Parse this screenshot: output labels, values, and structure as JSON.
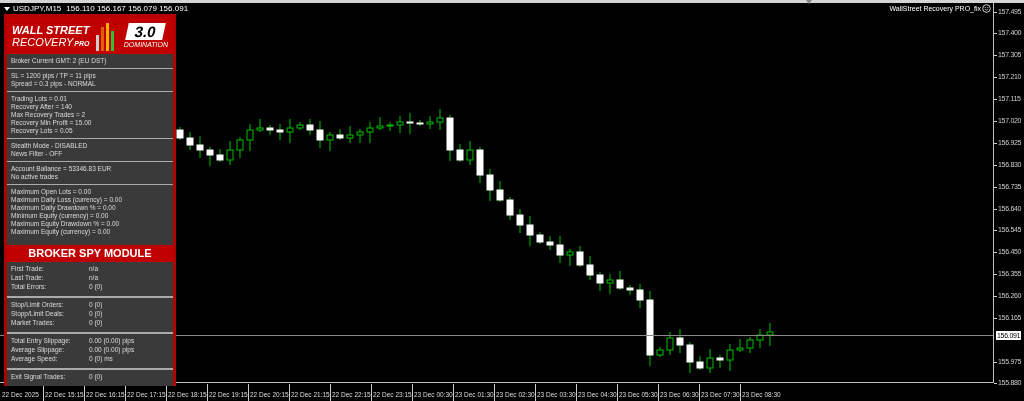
{
  "chart_header": {
    "symbol": "USDJPY,M15",
    "quotes": "156.110 156.167 156.079 156.091",
    "expert": "WallStreet Recovery PRO_fix"
  },
  "panel": {
    "logo": {
      "line1": "WALL STREET",
      "line2": "RECOVERY",
      "suffix": "PRO",
      "version": "3.0",
      "edition": "DOMINATION"
    },
    "sections": [
      [
        "Broker Current GMT: 2 (EU DST)"
      ],
      [
        "SL = 1200 pips / TP = 11 pips",
        "Spread = 0.3 pips - NORMAL"
      ],
      [
        "Trading Lots = 0.01",
        "Recovery After = 140",
        "Max Recovery Trades = 2",
        "Recovery Min Profit = 15.00",
        "Recovery Lots = 0.05"
      ],
      [
        "Stealth Mode - DISABLED",
        "News Filter - OFF"
      ],
      [
        "Account Ballance = 53346.83 EUR",
        "No active trades"
      ],
      [
        "Maximum Open Lots = 0.00",
        "Maximum Daily Loss (currency) = 0.00",
        "Maximum Daily Drawdown % = 0.00",
        "Minimum Equity (currency) = 0.00",
        "Maximum Equity Drawdown % = 0.00",
        "Maximum Equity (currency) = 0.00"
      ]
    ],
    "spy_title": "BROKER SPY MODULE",
    "spy_sections": [
      [
        {
          "label": "First Trade:",
          "value": "n/a"
        },
        {
          "label": "Last Trade:",
          "value": "n/a"
        },
        {
          "label": "Total Errors:",
          "value": "0 (0)"
        }
      ],
      [
        {
          "label": "Stop/Limit Orders:",
          "value": "0 (0)"
        },
        {
          "label": "Stopp/Limit Deals:",
          "value": "0 (0)"
        },
        {
          "label": "Market Trades:",
          "value": "0 (0)"
        }
      ],
      [
        {
          "label": "Total Entry Slippage:",
          "value": "0.00 (0.00) pips"
        },
        {
          "label": "Average Slippage:",
          "value": "0.00 (0.00) pips"
        },
        {
          "label": "Average Speed:",
          "value": "0 (0) ms"
        }
      ],
      [
        {
          "label": "Exit Signal Trades:",
          "value": "0 (0)"
        }
      ]
    ]
  },
  "price_axis": [
    "157.495",
    "157.400",
    "157.305",
    "157.210",
    "157.115",
    "157.020",
    "156.925",
    "156.830",
    "156.735",
    "156.640",
    "156.545",
    "156.450",
    "156.355",
    "156.260",
    "156.165",
    "155.975",
    "155.880"
  ],
  "current_price": "156.091",
  "time_axis": [
    "22 Dec 2025",
    "22 Dec 15:15",
    "22 Dec 16:15",
    "22 Dec 17:15",
    "22 Dec 18:15",
    "22 Dec 19:15",
    "22 Dec 20:15",
    "22 Dec 21:15",
    "22 Dec 22:15",
    "22 Dec 23:15",
    "23 Dec 00:30",
    "23 Dec 01:30",
    "23 Dec 02:30",
    "23 Dec 03:30",
    "23 Dec 04:30",
    "23 Dec 05:30",
    "23 Dec 06:30",
    "23 Dec 07:30",
    "23 Dec 08:30"
  ]
}
